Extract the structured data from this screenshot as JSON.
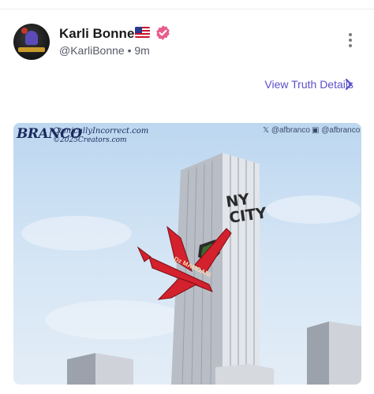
{
  "post": {
    "display_name": "Karli Bonne’",
    "handle": "@KarliBonne",
    "separator": "•",
    "time_ago": "9m",
    "flag_icon": "us-flag-icon",
    "verified_icon": "verified-badge-icon",
    "verified_color": "#e85d8a"
  },
  "actions": {
    "details_link": "View Truth Details",
    "link_color": "#5b4fc9"
  },
  "media": {
    "cartoon_brand": "BRANCO",
    "cartoon_site": "ComicallyIncorrect.com",
    "cartoon_copyright": "©2025Creators.com",
    "credit_x": "@afbranco",
    "credit_truth": "@afbranco",
    "tower_text_line1": "NY",
    "tower_text_line2": "CITY",
    "plane_text": "Dz MAMDANI"
  }
}
